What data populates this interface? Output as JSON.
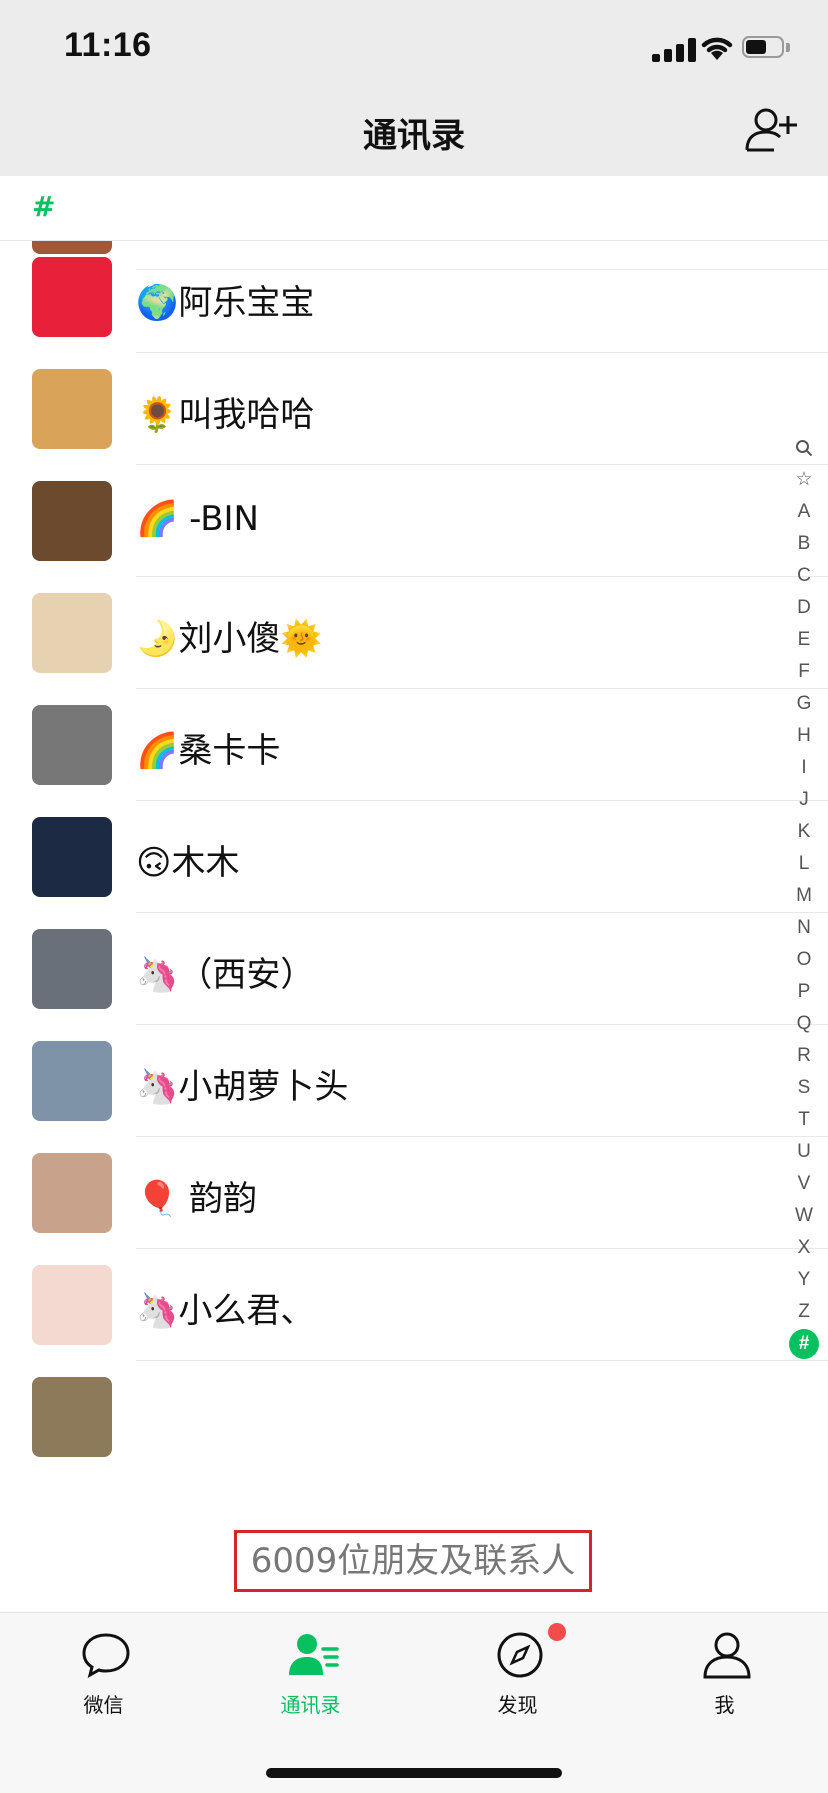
{
  "status_bar": {
    "time": "11:16"
  },
  "header": {
    "title": "通讯录"
  },
  "section": {
    "letter": "#"
  },
  "contacts": [
    {
      "name": "🌍阿乐宝宝",
      "avatar_color": "#e8203a"
    },
    {
      "name": "🌻叫我哈哈",
      "avatar_color": "#d9a35a"
    },
    {
      "name": "🌈 -BIN",
      "avatar_color": "#6b4a2e"
    },
    {
      "name": "🌛刘小傻🌞",
      "avatar_color": "#e6d2b0"
    },
    {
      "name": "🌈桑卡卡",
      "avatar_color": "#777777"
    },
    {
      "name": "🙃木木",
      "avatar_color": "#1c2a44"
    },
    {
      "name": "🦄（西安）",
      "avatar_color": "#6a707a"
    },
    {
      "name": "🦄小胡萝卜头",
      "avatar_color": "#7f93a8"
    },
    {
      "name": "🎈 韵韵",
      "avatar_color": "#c8a28a"
    },
    {
      "name": "🦄小么君、",
      "avatar_color": "#f3d9cf"
    }
  ],
  "index_letters": [
    "A",
    "B",
    "C",
    "D",
    "E",
    "F",
    "G",
    "H",
    "I",
    "J",
    "K",
    "L",
    "M",
    "N",
    "O",
    "P",
    "Q",
    "R",
    "S",
    "T",
    "U",
    "V",
    "W",
    "X",
    "Y",
    "Z",
    "#"
  ],
  "footer": {
    "count_text": "6009位朋友及联系人"
  },
  "tabbar": {
    "tabs": [
      {
        "label": "微信",
        "icon": "chat-bubble-icon"
      },
      {
        "label": "通讯录",
        "icon": "contacts-icon"
      },
      {
        "label": "发现",
        "icon": "compass-icon"
      },
      {
        "label": "我",
        "icon": "person-icon"
      }
    ]
  },
  "colors": {
    "accent": "#07c160",
    "highlight_border": "#d4252b",
    "badge": "#f24c4c"
  }
}
